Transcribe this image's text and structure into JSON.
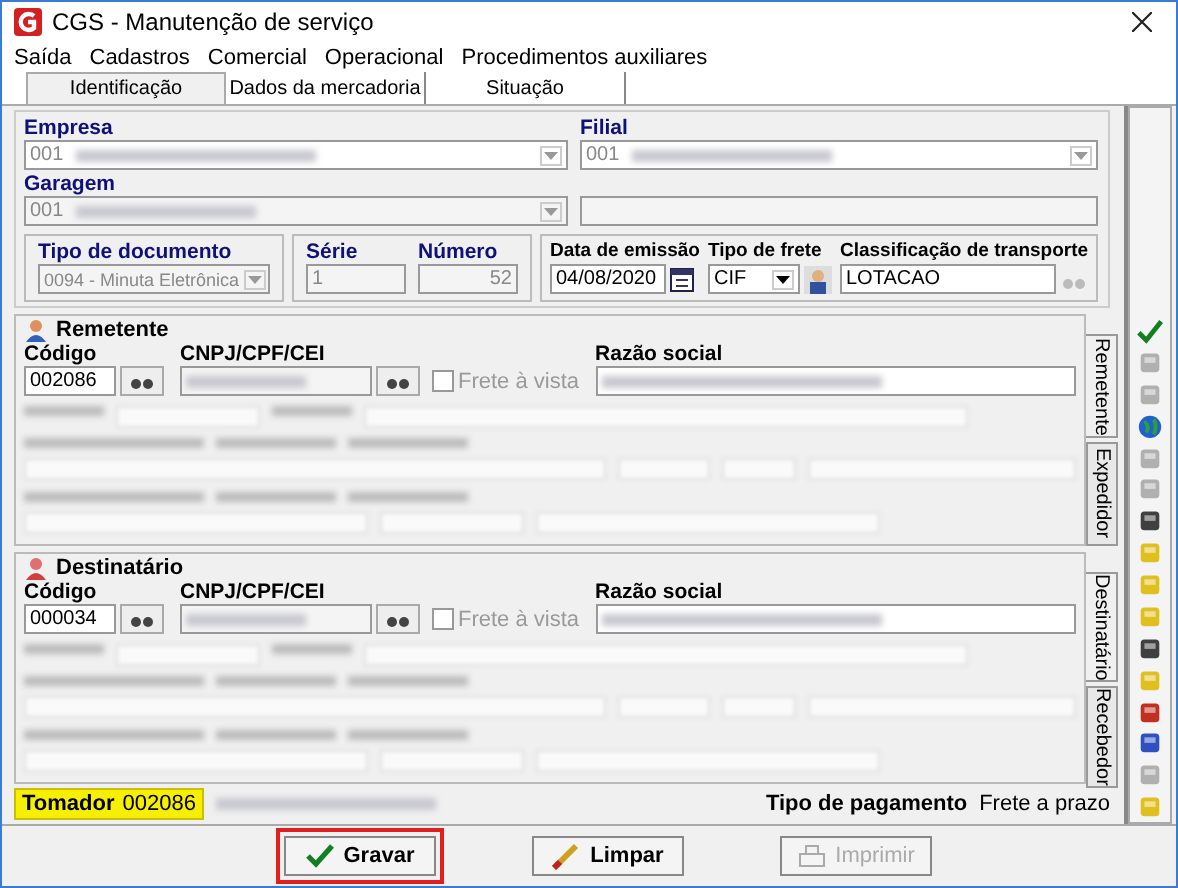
{
  "window": {
    "title": "CGS - Manutenção de serviço"
  },
  "menu": [
    "Saída",
    "Cadastros",
    "Comercial",
    "Operacional",
    "Procedimentos auxiliares"
  ],
  "tabs": [
    {
      "label": "Identificação",
      "selected": true
    },
    {
      "label": "Dados da mercadoria",
      "selected": false
    },
    {
      "label": "Situação",
      "selected": false
    }
  ],
  "empresa": {
    "label": "Empresa",
    "value": "001"
  },
  "filial": {
    "label": "Filial",
    "value": "001"
  },
  "garagem": {
    "label": "Garagem",
    "value": "001"
  },
  "documento": {
    "tipo_label": "Tipo de documento",
    "tipo_value": "0094 - Minuta Eletrônica",
    "serie_label": "Série",
    "serie_value": "1",
    "numero_label": "Número",
    "numero_value": "52",
    "data_label": "Data de emissão",
    "data_value": "04/08/2020",
    "frete_label": "Tipo de frete",
    "frete_value": "CIF",
    "classificacao_label": "Classificação de transporte",
    "classificacao_value": "LOTACAO"
  },
  "parties": [
    {
      "title": "Remetente",
      "codigo_label": "Código",
      "codigo": "002086",
      "cnpj_label": "CNPJ/CPF/CEI",
      "frete_vista": "Frete à vista",
      "frete_vista_checked": false,
      "razao_label": "Razão social",
      "side_tabs": [
        {
          "label": "Remetente",
          "selected": true
        },
        {
          "label": "Expedidor",
          "selected": false
        }
      ]
    },
    {
      "title": "Destinatário",
      "codigo_label": "Código",
      "codigo": "000034",
      "cnpj_label": "CNPJ/CPF/CEI",
      "frete_vista": "Frete à vista",
      "frete_vista_checked": false,
      "razao_label": "Razão social",
      "side_tabs": [
        {
          "label": "Destinatário",
          "selected": true
        },
        {
          "label": "Recebedor",
          "selected": false
        }
      ]
    }
  ],
  "tomador": {
    "label": "Tomador",
    "codigo": "002086"
  },
  "pagamento": {
    "label": "Tipo de pagamento",
    "value": "Frete a prazo"
  },
  "buttons": [
    {
      "label": "Gravar",
      "kind": "save",
      "disabled": false,
      "highlighted": true
    },
    {
      "label": "Limpar",
      "kind": "clear",
      "disabled": false,
      "highlighted": false
    },
    {
      "label": "Imprimir",
      "kind": "print",
      "disabled": true,
      "highlighted": false
    }
  ]
}
